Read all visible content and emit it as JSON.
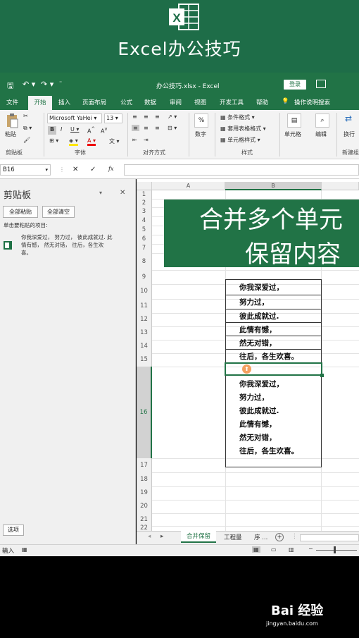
{
  "banner": {
    "title": "Excel办公技巧",
    "logo_letter": "X"
  },
  "titlebar": {
    "filename": "办公技巧.xlsx - Excel",
    "login": "登录"
  },
  "tabs": [
    "文件",
    "开始",
    "插入",
    "页面布局",
    "公式",
    "数据",
    "审阅",
    "视图",
    "开发工具",
    "帮助",
    "操作说明搜索"
  ],
  "ribbon": {
    "paste": "粘贴",
    "font_name": "Microsoft YaHei",
    "font_size": "13",
    "number": "数字",
    "percent": "%",
    "conditional": "条件格式 ▾",
    "table_format": "套用表格格式 ▾",
    "cell_style": "单元格样式 ▾",
    "cells": "单元格",
    "edit": "编辑",
    "wrap": "换行",
    "groups": {
      "clipboard": "剪贴板",
      "font": "字体",
      "align": "对齐方式",
      "styles": "样式",
      "new_group": "新建组"
    }
  },
  "formula": {
    "namebox": "B16",
    "fx": "fx"
  },
  "clipboard_pane": {
    "title": "剪贴板",
    "paste_all": "全部粘贴",
    "clear_all": "全部清空",
    "hint": "单击要粘贴的项目:",
    "item": "你我深爱过， 努力过， 彼此成就过. 此情有憾， 然无对错， 往后，各生欢喜。",
    "options": "选项"
  },
  "sheet": {
    "columns": [
      "A",
      "B"
    ],
    "row_numbers": [
      "1",
      "2",
      "3",
      "4",
      "5",
      "6",
      "7",
      "8",
      "9",
      "10",
      "11",
      "12",
      "13",
      "14",
      "15",
      "16",
      "17",
      "18",
      "19",
      "20",
      "21",
      "22"
    ],
    "merged_title_line1": "合并多个单元",
    "merged_title_line2": "保留内容",
    "lines": [
      "你我深爱过，",
      "努力过，",
      "彼此成就过.",
      "此情有憾，",
      "然无对错，",
      "往后，各生欢喜。"
    ],
    "b16_lines": [
      "你我深爱过，",
      "努力过，",
      "彼此成就过.",
      "此情有憾，",
      "然无对错，",
      "往后，各生欢喜。"
    ]
  },
  "sheet_tabs": {
    "active": "合并保留",
    "second": "工程量",
    "third": "序 ...",
    "add": "+"
  },
  "status": {
    "mode": "输入"
  },
  "watermark": {
    "brand": "Bai 经验",
    "url": "jingyan.baidu.com"
  },
  "colors": {
    "excel_green": "#217346",
    "banner_green": "#1e6d48"
  }
}
